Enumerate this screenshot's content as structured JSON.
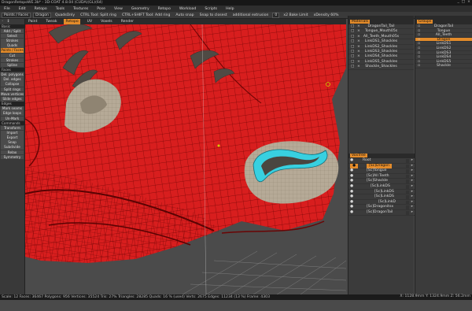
{
  "window": {
    "title": "DragonRetopoWE.3b* - 3D-COAT 4.8.04 (CUDA)(GL)(64)",
    "controls": [
      "_",
      "□",
      "×"
    ]
  },
  "menu": [
    "File",
    "Edit",
    "Retopo",
    "Tools",
    "Textures",
    "Pose",
    "View",
    "Geometry",
    "Retopo",
    "Workload",
    "Scripts",
    "Help"
  ],
  "toolbar": {
    "mode": "Points / Faces",
    "group": "Dragon",
    "quadsonly": "QuadsOnly",
    "ctrl_tool": "CTRL Tool: Split ring",
    "ctrl_shift": "CTRL+SHIFT Tool: Add ring",
    "auto_snap": "Auto snap",
    "snap": "Snap to closest",
    "additional": "additional extrusion",
    "edit": "0",
    "bake": "x2 Bake Limit",
    "density": "xDensity 60%",
    "camera": "[Camera]"
  },
  "tabs": [
    "Paint",
    "Tweak",
    "Retopo",
    "UV",
    "Voxels",
    "Render"
  ],
  "tabs_active": 2,
  "left_panel": {
    "sections": [
      {
        "header": "Basic",
        "buttons": [
          "Add / Split",
          "Select",
          "Strokes",
          "Quads",
          "Points / Faces",
          "Cut",
          "Strokes",
          "Spline"
        ]
      },
      {
        "header": "Faces",
        "buttons": [
          "Del. polygons",
          "Del. edges",
          "Collapse",
          "Split rings",
          "Move vertices",
          "Slide edges"
        ]
      },
      {
        "header": "Edges",
        "buttons": [
          "Mark seams",
          "Edge loops",
          "Un-Mark"
        ]
      },
      {
        "header": "Commands",
        "buttons": [
          "Transform",
          "Import",
          "Export",
          "Snap",
          "Subdivide",
          "Relax",
          "Symmetry"
        ]
      }
    ],
    "active": "Points / Faces"
  },
  "materials": {
    "title": "Materials",
    "items": [
      "DragonTail_Tail",
      "Tongue_Mouth05s",
      "All_Teeth_Mouth05s",
      "LinkDS1_Shackles",
      "LinkDS2_Shackles",
      "LinkDS3_Shackles",
      "LinkDS4_Shackles",
      "LinkDS5_Shackles",
      "Shackle_Shackles"
    ]
  },
  "groups": {
    "title": "Groups",
    "items": [
      "DragonTail",
      "Tongue",
      "All_Teeth",
      "Dragon",
      "LinkDS1",
      "LinkDS2",
      "LinkDS3",
      "LinkDS4",
      "LinkDS5",
      "Shackle"
    ],
    "active": "Dragon"
  },
  "voxtree": {
    "title": "VoxTree",
    "items": [
      {
        "label": "Root",
        "depth": 0
      },
      {
        "label": "[Sc]Dragon",
        "depth": 1,
        "active": true
      },
      {
        "label": "[Sc]Tongue",
        "depth": 1
      },
      {
        "label": "[Sc]All Teeth",
        "depth": 1
      },
      {
        "label": "[Sc]Shackle",
        "depth": 1
      },
      {
        "label": "[Sc]LinkDS",
        "depth": 2
      },
      {
        "label": "[Sc]LinkDS",
        "depth": 3
      },
      {
        "label": "[Sc]LinkDS",
        "depth": 3
      },
      {
        "label": "[Sc]LinkD",
        "depth": 4
      },
      {
        "label": "[Sc]Dragonitsx",
        "depth": 1
      },
      {
        "label": "[Sc]DragonTail",
        "depth": 1
      }
    ]
  },
  "status": {
    "text": "Scale: 12  Faces: 36467  Polygons: 956  Vertices: 35524  Tris: 27%  Triangles: 28285  Quads: 16 % (used)  Verts: 2675  Edges: 11234 (13 %)  Frame: 4303",
    "right": "X: 1128.9mm  Y: 1324.9mm  Z: 56.2mm"
  },
  "colors": {
    "accent": "#e38b2a",
    "mesh_red": "#d81e1e",
    "scale_gray": "#b6aa97",
    "selection": "#38d0e0"
  }
}
